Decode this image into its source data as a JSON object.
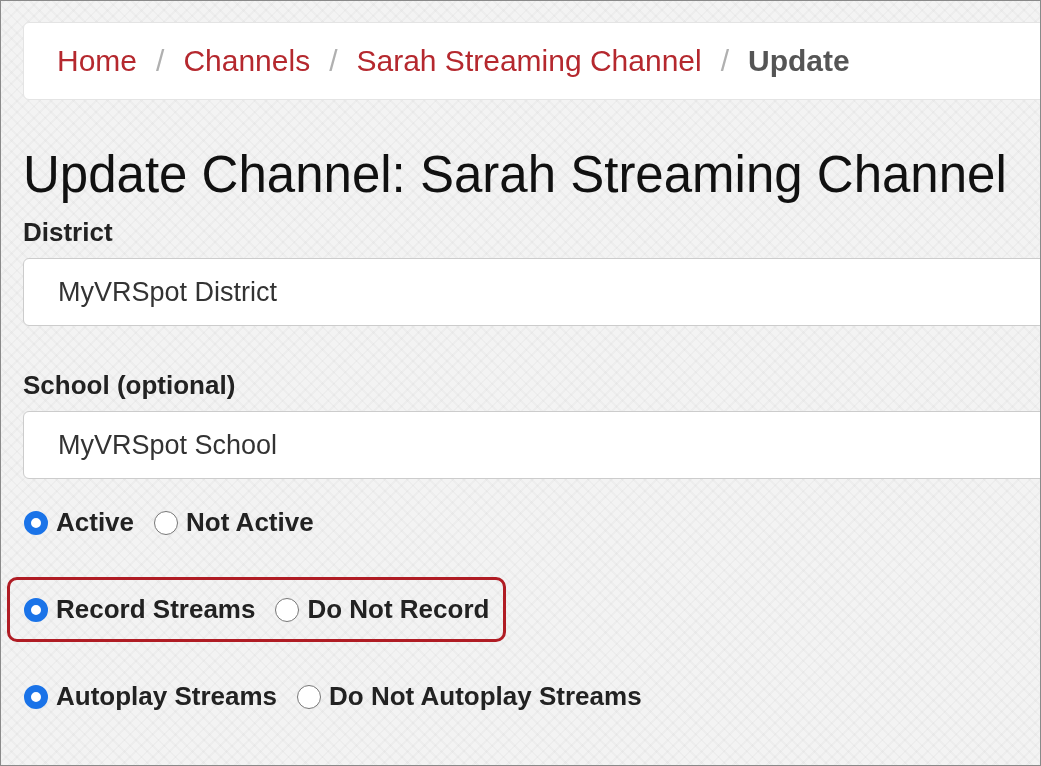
{
  "breadcrumb": [
    {
      "label": "Home",
      "current": false
    },
    {
      "label": "Channels",
      "current": false
    },
    {
      "label": "Sarah Streaming Channel",
      "current": false
    },
    {
      "label": "Update",
      "current": true
    }
  ],
  "separator": "/",
  "title": "Update Channel: Sarah Streaming Channel",
  "fields": [
    {
      "label": "District",
      "value": "MyVRSpot District"
    },
    {
      "label": "School (optional)",
      "value": "MyVRSpot School"
    }
  ],
  "radio_groups": [
    {
      "highlighted": false,
      "options": [
        {
          "label": "Active",
          "selected": true
        },
        {
          "label": "Not Active",
          "selected": false
        }
      ]
    },
    {
      "highlighted": true,
      "options": [
        {
          "label": "Record Streams",
          "selected": true
        },
        {
          "label": "Do Not Record",
          "selected": false
        }
      ]
    },
    {
      "highlighted": false,
      "options": [
        {
          "label": "Autoplay Streams",
          "selected": true
        },
        {
          "label": "Do Not Autoplay Streams",
          "selected": false
        }
      ]
    }
  ]
}
